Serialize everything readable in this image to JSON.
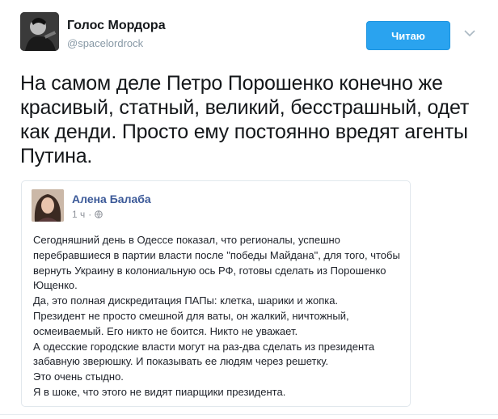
{
  "tweet": {
    "author_name": "Голос Мордора",
    "author_handle": "@spacelordrock",
    "follow_button_label": "Читаю",
    "text": "На самом деле Петро Порошенко конечно же красивый, статный, великий, бесстрашный, одет как денди. Просто ему постоянно вредят агенты Путина."
  },
  "embedded_post": {
    "author_name": "Алена Балаба",
    "time": "1 ч",
    "separator": "·",
    "privacy_icon": "globe-icon",
    "lines": [
      "Сегодняшний день в Одессе показал, что регионалы, успешно перебравшиеся в партии власти после \"победы Майдана\", для того, чтобы вернуть Украину в колониальную ось РФ, готовы сделать из Порошенко Ющенко.",
      "Да, это полная дискредитация ПАПы: клетка, шарики и жопка.",
      "Президент не просто смешной для ваты, он жалкий, ничтожный, осмеиваемый. Его никто не боится. Никто не уважает.",
      "А одесские городские власти могут на раз-два сделать из президента забавную зверюшку. И показывать ее людям через решетку.",
      "Это очень стыдно.",
      "Я в шоке, что этого не видят пиарщики президента."
    ]
  },
  "colors": {
    "follow_button": "#2aa3ef",
    "fb_author": "#3b5998",
    "handle": "#8899a6"
  }
}
